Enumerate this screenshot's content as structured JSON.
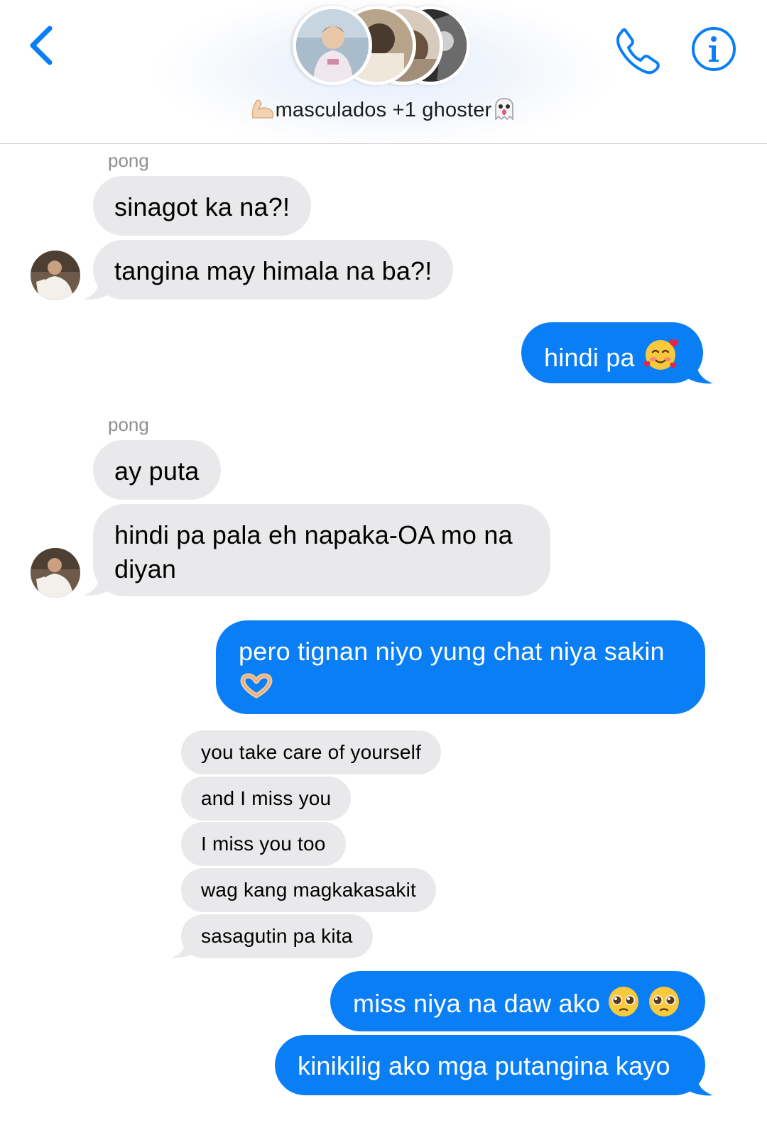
{
  "header": {
    "back_icon": "chevron-left-icon",
    "call_icon": "phone-icon",
    "info_icon": "info-icon",
    "title_prefix_emoji": "flexed-biceps-emoji",
    "title": "masculados +1 ghoster",
    "title_suffix_emoji": "ghost-emoji",
    "accent_color": "#0a7ff5"
  },
  "messages": {
    "g1_sender": "pong",
    "m1": "sinagot ka na?!",
    "m2": "tangina may himala na ba?!",
    "m3": "hindi pa",
    "m3_emoji": "smiling-face-with-hearts-emoji",
    "g2_sender": "pong",
    "m4": "ay puta",
    "m5": "hindi pa pala eh napaka-OA mo na diyan",
    "m6": "pero tignan niyo yung chat niya sakin",
    "m6_emoji": "heart-hands-emoji",
    "q1": "you take care of yourself",
    "q2": "and I miss you",
    "q3": "I miss you too",
    "q4": "wag kang magkakasakit",
    "q5": "sasagutin pa kita",
    "m7": "miss niya na daw ako",
    "m7_emoji": "pleading-face-emoji",
    "m8": "kinikilig ako mga putangina kayo"
  },
  "colors": {
    "incoming_bubble": "#e9e9eb",
    "outgoing_bubble": "#0a7ff5"
  }
}
